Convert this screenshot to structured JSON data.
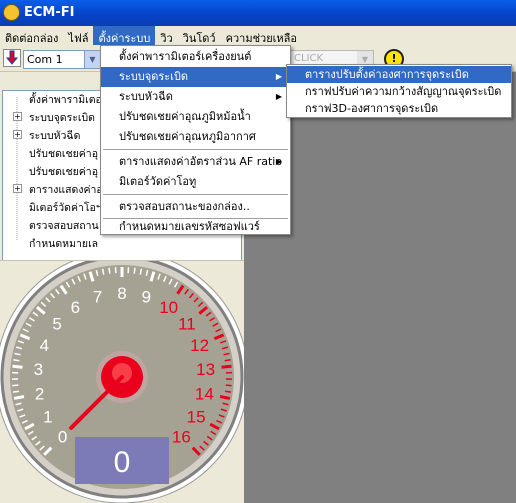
{
  "window": {
    "title": "ECM-FI"
  },
  "menubar": [
    "ติดต่อกล่อง",
    "ไฟล์",
    "ตั้งค่าระบบ",
    "วิว",
    "วินโดว์",
    "ความช่วยเหลือ"
  ],
  "toolbar": {
    "com_port": "Com 1",
    "disabled_combo": "CLICK"
  },
  "tree": [
    {
      "label": "ตั้งค่าพารามิเตอร์",
      "expandable": false
    },
    {
      "label": "ระบบจุดระเบิด",
      "expandable": true
    },
    {
      "label": "ระบบหัวฉีด",
      "expandable": true
    },
    {
      "label": "ปรับชดเชยค่าอุ",
      "expandable": false
    },
    {
      "label": "ปรับชดเชยค่าอุ",
      "expandable": false
    },
    {
      "label": "ตารางแสดงค่าอ",
      "expandable": true
    },
    {
      "label": "มิเตอร์วัดค่าโอฯ",
      "expandable": false
    },
    {
      "label": "ตรวจสอบสถาน",
      "expandable": false
    },
    {
      "label": "กำหนดหมายเล",
      "expandable": false
    }
  ],
  "settings_menu": {
    "items": [
      {
        "label": "ตั้งค่าพารามิเตอร์เครื่องยนต์",
        "submenu": false
      },
      {
        "label": "ระบบจุดระเบิด",
        "submenu": true,
        "highlighted": true
      },
      {
        "label": "ระบบหัวฉีด",
        "submenu": true
      },
      {
        "label": "ปรับชดเชยค่าอุณภูมิหม้อน้ำ",
        "submenu": false
      },
      {
        "label": "ปรับชดเชยค่าอุณหภูมิอากาศ",
        "submenu": false
      },
      {
        "label": "ตารางแสดงค่าอัตราส่วน AF ratio",
        "submenu": true
      },
      {
        "label": "มิเตอร์วัดค่าโอทู",
        "submenu": false
      },
      {
        "label": "ตรวจสอบสถานะของกล่อง..",
        "submenu": false
      },
      {
        "label": "กำหนดหมายเลขรหัสซอฟแวร์",
        "submenu": false
      }
    ]
  },
  "ignition_submenu": {
    "items": [
      {
        "label": "ตารางปรับตั้งค่าองศาการจุดระเบิด",
        "highlighted": true
      },
      {
        "label": "กราฟปรับค่าความกว้างสัญญาณจุดระเบิด"
      },
      {
        "label": "กราฟ3D-องศาการจุดระเบิด"
      }
    ]
  },
  "gauge": {
    "ticks_white": [
      "0",
      "1",
      "2",
      "3",
      "4",
      "5",
      "6",
      "7",
      "8",
      "9"
    ],
    "ticks_red": [
      "10",
      "11",
      "12",
      "13",
      "14",
      "15",
      "16"
    ],
    "needle_value": 0,
    "readout": "0",
    "colors": {
      "red": "#e8001c",
      "readout_bg": "#7d7ab8",
      "face": "#a6a293"
    }
  }
}
